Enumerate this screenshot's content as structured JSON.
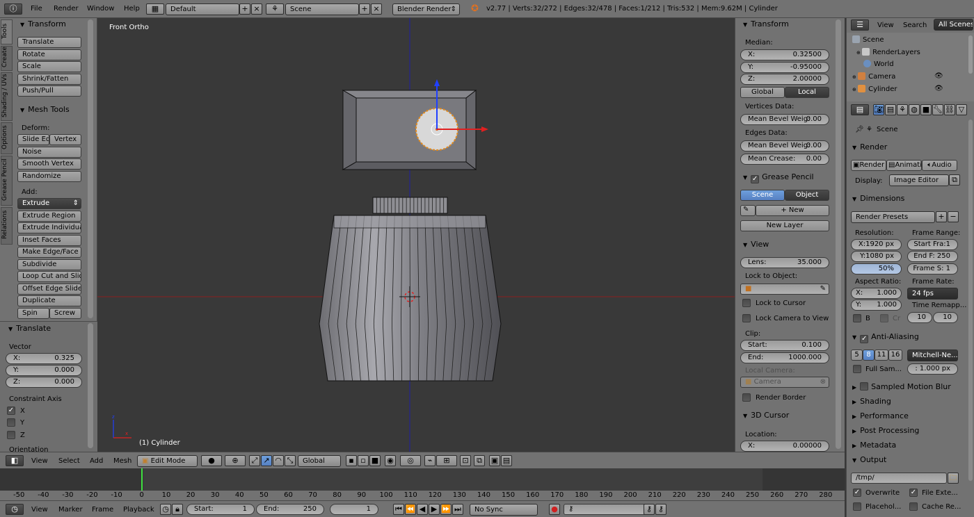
{
  "topbar": {
    "menus": [
      "File",
      "Render",
      "Window",
      "Help"
    ],
    "layout": "Default",
    "scene": "Scene",
    "engine": "Blender Render",
    "stats": "v2.77 | Verts:32/272 | Edges:32/478 | Faces:1/212 | Tris:532 | Mem:9.62M | Cylinder"
  },
  "tool_tabs": [
    "Tools",
    "Create",
    "Shading / UVs",
    "Options",
    "Grease Pencil",
    "Relations"
  ],
  "tools": {
    "transform_header": "Transform",
    "transform_buttons": [
      "Translate",
      "Rotate",
      "Scale",
      "Shrink/Fatten",
      "Push/Pull"
    ],
    "mesh_tools_header": "Mesh Tools",
    "deform_label": "Deform:",
    "slide_edge": "Slide Ed",
    "vertex": "Vertex",
    "noise": "Noise",
    "smooth_vertex": "Smooth Vertex",
    "randomize": "Randomize",
    "add_label": "Add:",
    "extrude": "Extrude",
    "add_buttons": [
      "Extrude Region",
      "Extrude Individual",
      "Inset Faces",
      "Make Edge/Face",
      "Subdivide",
      "Loop Cut and Slide",
      "Offset Edge Slide",
      "Duplicate"
    ],
    "spin": "Spin",
    "screw": "Screw"
  },
  "operator": {
    "header": "Translate",
    "vector_label": "Vector",
    "x": {
      "label": "X:",
      "value": "0.325"
    },
    "y": {
      "label": "Y:",
      "value": "0.000"
    },
    "z": {
      "label": "Z:",
      "value": "0.000"
    },
    "constraint_label": "Constraint Axis",
    "axes": [
      {
        "label": "X",
        "checked": true
      },
      {
        "label": "Y",
        "checked": false
      },
      {
        "label": "Z",
        "checked": false
      }
    ],
    "orientation_label": "Orientation"
  },
  "viewport": {
    "view_name": "Front Ortho",
    "object_label": "(1) Cylinder"
  },
  "npanel": {
    "transform_header": "Transform",
    "median_label": "Median:",
    "x": {
      "label": "X:",
      "value": "0.32500"
    },
    "y": {
      "label": "Y:",
      "value": "-0.95000"
    },
    "z": {
      "label": "Z:",
      "value": "2.00000"
    },
    "global": "Global",
    "local": "Local",
    "vertices_data": "Vertices Data:",
    "vert_bevel": {
      "label": "Mean Bevel Weig:",
      "value": "0.00"
    },
    "edges_data": "Edges Data:",
    "edge_bevel": {
      "label": "Mean Bevel Weig:",
      "value": "0.00"
    },
    "crease": {
      "label": "Mean Crease:",
      "value": "0.00"
    },
    "grease_header": "Grease Pencil",
    "gp_scene": "Scene",
    "gp_object": "Object",
    "gp_new": "New",
    "gp_new_layer": "New Layer",
    "view_header": "View",
    "lens": {
      "label": "Lens:",
      "value": "35.000"
    },
    "lock_to_object": "Lock to Object:",
    "lock_to_cursor": "Lock to Cursor",
    "lock_camera": "Lock Camera to View",
    "clip_label": "Clip:",
    "clip_start": {
      "label": "Start:",
      "value": "0.100"
    },
    "clip_end": {
      "label": "End:",
      "value": "1000.000"
    },
    "local_camera": "Local Camera:",
    "camera": "Camera",
    "render_border": "Render Border",
    "cursor_header": "3D Cursor",
    "location_label": "Location:",
    "cursor_x": {
      "label": "X:",
      "value": "0.00000"
    }
  },
  "header3d": {
    "menus": [
      "View",
      "Select",
      "Add",
      "Mesh"
    ],
    "mode": "Edit Mode",
    "orientation": "Global"
  },
  "timeline": {
    "ticks": [
      "-50",
      "-40",
      "-30",
      "-20",
      "-10",
      "0",
      "10",
      "20",
      "30",
      "40",
      "50",
      "60",
      "70",
      "80",
      "90",
      "100",
      "110",
      "120",
      "130",
      "140",
      "150",
      "160",
      "170",
      "180",
      "190",
      "200",
      "210",
      "220",
      "230",
      "240",
      "250",
      "260",
      "270",
      "280"
    ],
    "current_frame": 0,
    "range": [
      -50,
      280
    ],
    "menus": [
      "View",
      "Marker",
      "Frame",
      "Playback"
    ],
    "start": {
      "label": "Start:",
      "value": "1"
    },
    "end": {
      "label": "End:",
      "value": "250"
    },
    "frame": "1",
    "sync": "No Sync"
  },
  "outliner": {
    "menus": [
      "View",
      "Search"
    ],
    "filter": "All Scenes",
    "items": [
      "Scene",
      "RenderLayers",
      "World",
      "Camera",
      "Cylinder"
    ]
  },
  "properties": {
    "scene": "Scene",
    "render_header": "Render",
    "render_btn": "Render",
    "anim_btn": "Animati",
    "audio_btn": "Audio",
    "display_label": "Display:",
    "display_value": "Image Editor",
    "dimensions_header": "Dimensions",
    "presets": "Render Presets",
    "resolution_label": "Resolution:",
    "frame_range_label": "Frame Range:",
    "res_x": "X:1920 px",
    "res_y": "Y:1080 px",
    "res_pct": "50%",
    "start_frame": "Start Fra:1",
    "end_frame": "End F: 250",
    "frame_step": "Frame S: 1",
    "aspect_label": "Aspect Ratio:",
    "framerate_label": "Frame Rate:",
    "aspect_x": {
      "label": "X:",
      "value": "1.000"
    },
    "aspect_y": {
      "label": "Y:",
      "value": "1.000"
    },
    "fps": "24 fps",
    "time_remap": "Time Remapp...",
    "remap_old": "10",
    "remap_new": "10",
    "border_b": "B",
    "border_cr": "Cr",
    "aa_header": "Anti-Aliasing",
    "aa_samples": [
      "5",
      "8",
      "11",
      "16"
    ],
    "aa_filter": "Mitchell-Ne...",
    "full_sample": "Full Sam...",
    "filter_size": ": 1.000 px",
    "motion_blur": "Sampled Motion Blur",
    "shading": "Shading",
    "performance": "Performance",
    "post_processing": "Post Processing",
    "metadata": "Metadata",
    "output_header": "Output",
    "output_path": "/tmp/",
    "overwrite": "Overwrite",
    "file_ext": "File Exte...",
    "placeholders": "Placehol...",
    "cache_result": "Cache Re..."
  },
  "colors": {
    "accent": "#5680c2",
    "panel": "#727272",
    "viewport": "#393939",
    "x_axis": "#e02020",
    "y_axis": "#2050ff"
  }
}
